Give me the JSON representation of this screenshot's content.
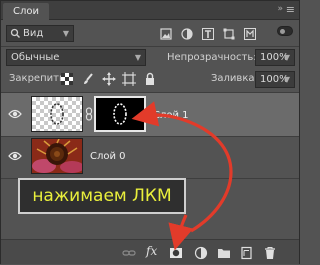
{
  "tab": {
    "label": "Слои"
  },
  "filter": {
    "kind": "Вид"
  },
  "blend": {
    "mode": "Обычные",
    "opacity_label": "Непрозрачность:",
    "opacity_value": "100%"
  },
  "lock": {
    "label": "Закрепить:",
    "fill_label": "Заливка:",
    "fill_value": "100%"
  },
  "layers": [
    {
      "name": "Слой 1"
    },
    {
      "name": "Слой 0"
    }
  ],
  "callout": {
    "text": "нажимаем ЛКМ"
  },
  "bottom": {
    "fx": "fx"
  },
  "colors": {
    "panel": "#535353",
    "selected_row": "#6b6b6b",
    "arrow": "#e23b2a",
    "callout_text": "#e9ef3c"
  }
}
